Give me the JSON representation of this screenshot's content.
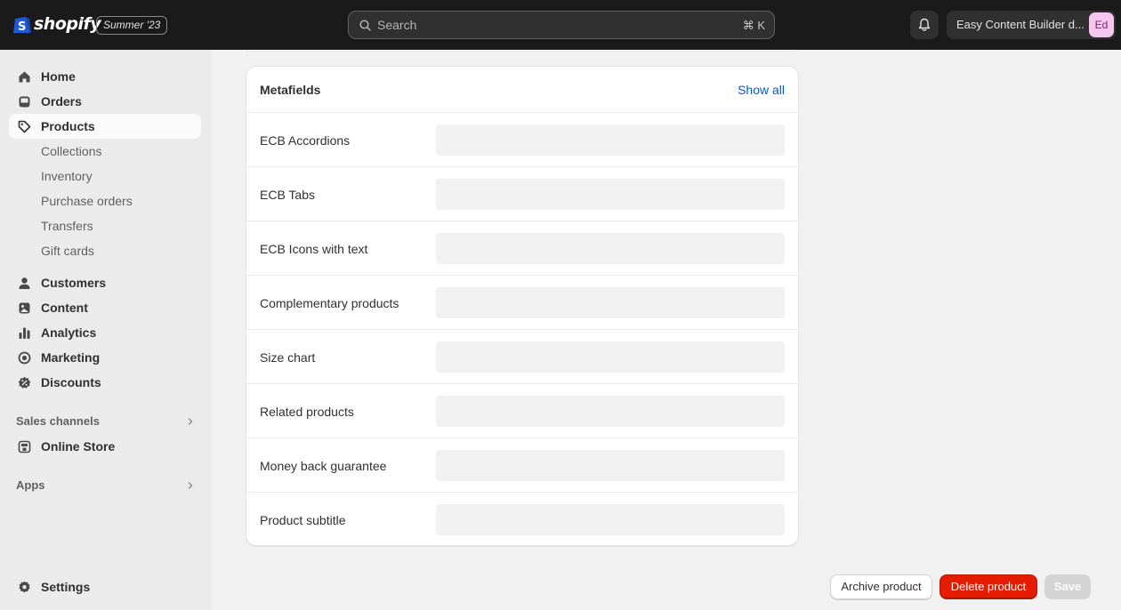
{
  "topbar": {
    "brand": "shopify",
    "edition": "Summer '23",
    "search_placeholder": "Search",
    "search_shortcut": "⌘ K",
    "store_name": "Easy Content Builder d...",
    "avatar_initials": "Ed"
  },
  "sidebar": {
    "items": [
      {
        "label": "Home",
        "icon": "home-icon"
      },
      {
        "label": "Orders",
        "icon": "inbox-icon"
      },
      {
        "label": "Products",
        "icon": "tag-icon",
        "active": true
      },
      {
        "label": "Collections"
      },
      {
        "label": "Inventory"
      },
      {
        "label": "Purchase orders"
      },
      {
        "label": "Transfers"
      },
      {
        "label": "Gift cards"
      },
      {
        "label": "Customers",
        "icon": "person-icon"
      },
      {
        "label": "Content",
        "icon": "image-icon"
      },
      {
        "label": "Analytics",
        "icon": "bar-chart-icon"
      },
      {
        "label": "Marketing",
        "icon": "target-icon"
      },
      {
        "label": "Discounts",
        "icon": "discount-icon"
      }
    ],
    "sales_channels_label": "Sales channels",
    "online_store_label": "Online Store",
    "apps_label": "Apps",
    "settings_label": "Settings"
  },
  "metafields": {
    "title": "Metafields",
    "show_all": "Show all",
    "rows": [
      {
        "label": "ECB Accordions",
        "value": ""
      },
      {
        "label": "ECB Tabs",
        "value": ""
      },
      {
        "label": "ECB Icons with text",
        "value": ""
      },
      {
        "label": "Complementary products",
        "value": ""
      },
      {
        "label": "Size chart",
        "value": ""
      },
      {
        "label": "Related products",
        "value": ""
      },
      {
        "label": "Money back guarantee",
        "value": ""
      },
      {
        "label": "Product subtitle",
        "value": ""
      }
    ]
  },
  "footer": {
    "archive_label": "Archive product",
    "delete_label": "Delete product",
    "save_label": "Save"
  },
  "colors": {
    "accent_link": "#005bd3",
    "danger": "#e51c00",
    "topbar_bg": "#1a1a1a"
  }
}
